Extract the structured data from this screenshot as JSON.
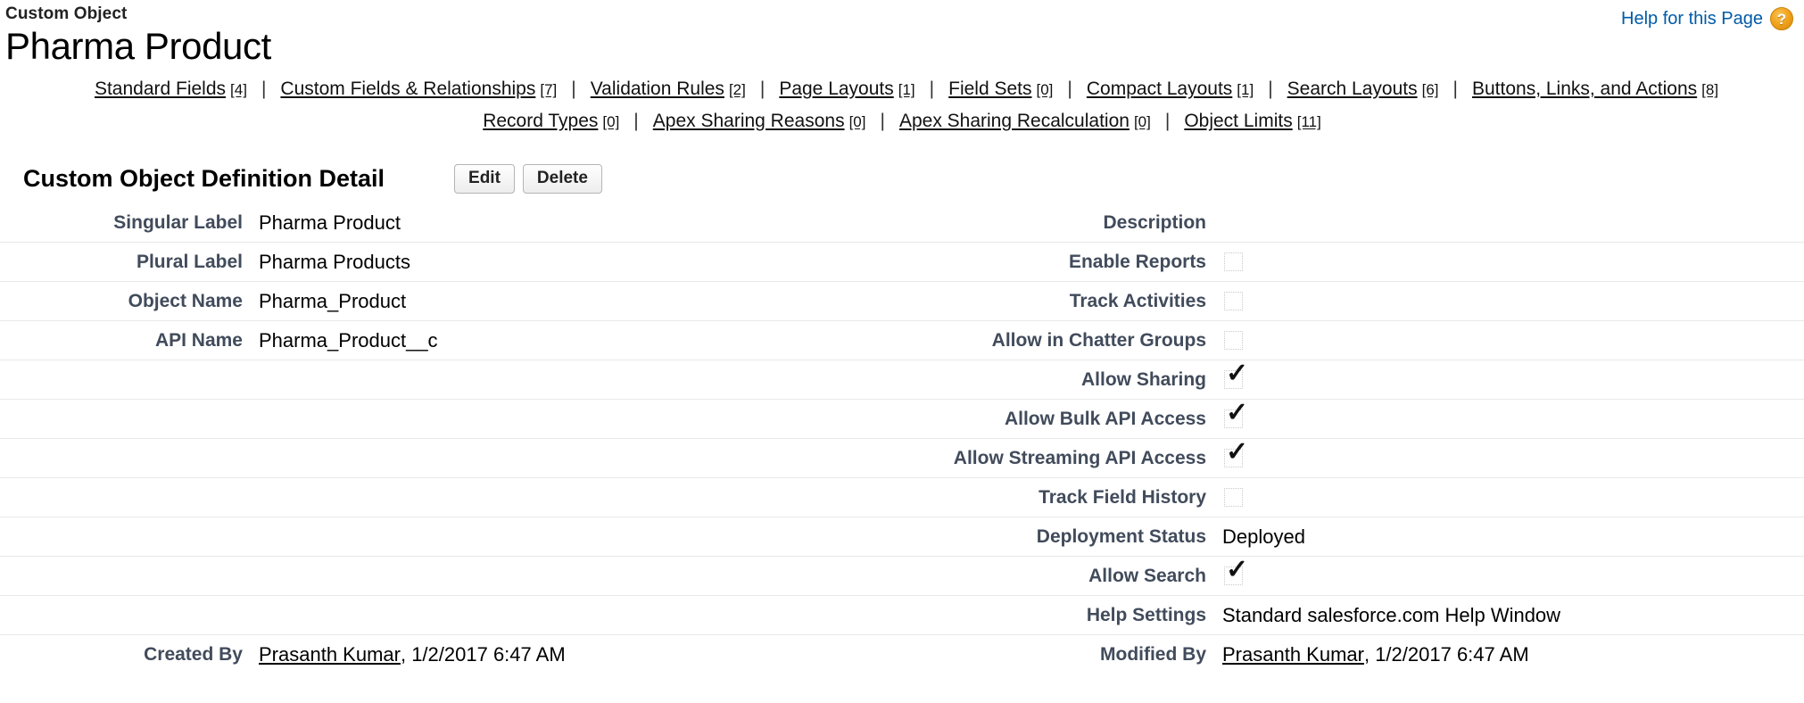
{
  "header": {
    "eyebrow": "Custom Object",
    "title": "Pharma Product",
    "help_link": "Help for this Page",
    "help_icon": "question-mark-icon",
    "help_icon_glyph": "?",
    "link_color": "#015ba7",
    "help_icon_color": "#f0a31c"
  },
  "nav": {
    "separator": "|",
    "row1": [
      {
        "label": "Standard Fields",
        "count": "[4]"
      },
      {
        "label": "Custom Fields & Relationships",
        "count": "[7]"
      },
      {
        "label": "Validation Rules",
        "count": "[2]"
      },
      {
        "label": "Page Layouts",
        "count": "[1]"
      },
      {
        "label": "Field Sets",
        "count": "[0]"
      },
      {
        "label": "Compact Layouts",
        "count": "[1]"
      },
      {
        "label": "Search Layouts",
        "count": "[6]"
      },
      {
        "label": "Buttons, Links, and Actions",
        "count": "[8]"
      }
    ],
    "row2": [
      {
        "label": "Record Types",
        "count": "[0]"
      },
      {
        "label": "Apex Sharing Reasons",
        "count": "[0]"
      },
      {
        "label": "Apex Sharing Recalculation",
        "count": "[0]"
      },
      {
        "label": "Object Limits",
        "count": "[11]"
      }
    ]
  },
  "section": {
    "title": "Custom Object Definition Detail",
    "edit_label": "Edit",
    "delete_label": "Delete"
  },
  "detail": {
    "rows": [
      {
        "left_label": "Singular Label",
        "left_value": "Pharma Product",
        "left_type": "text",
        "right_label": "Description",
        "right_value": "",
        "right_type": "text"
      },
      {
        "left_label": "Plural Label",
        "left_value": "Pharma Products",
        "left_type": "text",
        "right_label": "Enable Reports",
        "right_value": "unchecked",
        "right_type": "checkbox"
      },
      {
        "left_label": "Object Name",
        "left_value": "Pharma_Product",
        "left_type": "text",
        "right_label": "Track Activities",
        "right_value": "unchecked",
        "right_type": "checkbox"
      },
      {
        "left_label": "API Name",
        "left_value": "Pharma_Product__c",
        "left_type": "text",
        "right_label": "Allow in Chatter Groups",
        "right_value": "unchecked",
        "right_type": "checkbox"
      },
      {
        "left_label": "",
        "left_value": "",
        "left_type": "text",
        "right_label": "Allow Sharing",
        "right_value": "checked",
        "right_type": "checkbox"
      },
      {
        "left_label": "",
        "left_value": "",
        "left_type": "text",
        "right_label": "Allow Bulk API Access",
        "right_value": "checked",
        "right_type": "checkbox"
      },
      {
        "left_label": "",
        "left_value": "",
        "left_type": "text",
        "right_label": "Allow Streaming API Access",
        "right_value": "checked",
        "right_type": "checkbox"
      },
      {
        "left_label": "",
        "left_value": "",
        "left_type": "text",
        "right_label": "Track Field History",
        "right_value": "unchecked",
        "right_type": "checkbox"
      },
      {
        "left_label": "",
        "left_value": "",
        "left_type": "text",
        "right_label": "Deployment Status",
        "right_value": "Deployed",
        "right_type": "text"
      },
      {
        "left_label": "",
        "left_value": "",
        "left_type": "text",
        "right_label": "Allow Search",
        "right_value": "checked",
        "right_type": "checkbox"
      },
      {
        "left_label": "",
        "left_value": "",
        "left_type": "text",
        "right_label": "Help Settings",
        "right_value": "Standard salesforce.com Help Window",
        "right_type": "text"
      },
      {
        "left_label": "Created By",
        "left_link": "Prasanth Kumar",
        "left_value": ", 1/2/2017 6:47 AM",
        "left_type": "link",
        "right_label": "Modified By",
        "right_link": "Prasanth Kumar",
        "right_value": ", 1/2/2017 6:47 AM",
        "right_type": "link"
      }
    ]
  }
}
